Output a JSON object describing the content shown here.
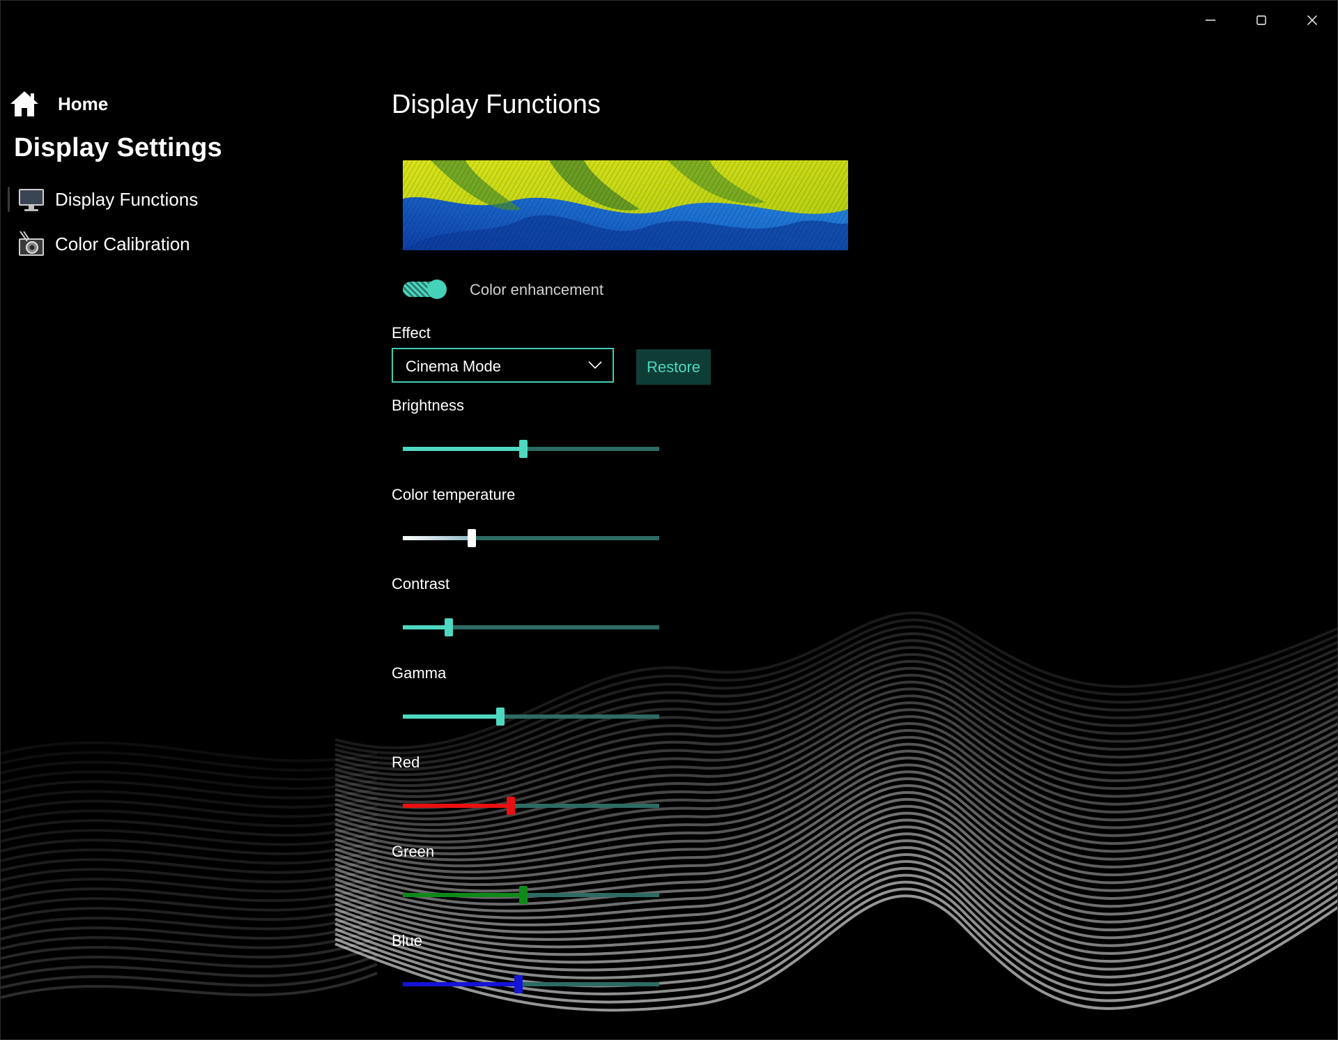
{
  "window": {
    "controls": {
      "minimize": "minimize-icon",
      "maximize": "maximize-icon",
      "close": "close-icon"
    }
  },
  "sidebar": {
    "home_label": "Home",
    "title": "Display Settings",
    "items": [
      {
        "label": "Display Functions",
        "icon": "monitor-icon",
        "selected": true
      },
      {
        "label": "Color Calibration",
        "icon": "calibration-icon",
        "selected": false
      }
    ]
  },
  "main": {
    "title": "Display Functions",
    "preview_image": "feathers-image",
    "color_enhancement": {
      "label": "Color enhancement",
      "on": true
    },
    "effect": {
      "label": "Effect",
      "selected": "Cinema Mode",
      "restore_label": "Restore"
    },
    "sliders": [
      {
        "label": "Brightness",
        "value": 0.47,
        "fill_color": "#4fd8c1",
        "thumb_color": "#4fd8c1"
      },
      {
        "label": "Color temperature",
        "value": 0.27,
        "fill_color": "#ffffff",
        "thumb_color": "#ffffff"
      },
      {
        "label": "Contrast",
        "value": 0.18,
        "fill_color": "#4fd8c1",
        "thumb_color": "#4fd8c1"
      },
      {
        "label": "Gamma",
        "value": 0.38,
        "fill_color": "#4fd8c1",
        "thumb_color": "#4fd8c1"
      },
      {
        "label": "Red",
        "value": 0.42,
        "fill_color": "#e81010",
        "thumb_color": "#e81010"
      },
      {
        "label": "Green",
        "value": 0.47,
        "fill_color": "#0f8a1a",
        "thumb_color": "#0f8a1a"
      },
      {
        "label": "Blue",
        "value": 0.45,
        "fill_color": "#1414d8",
        "thumb_color": "#1414d8"
      }
    ]
  },
  "colors": {
    "accent": "#4fd8c1",
    "rail": "#2d6b63",
    "restore_bg": "#0e3d36"
  }
}
